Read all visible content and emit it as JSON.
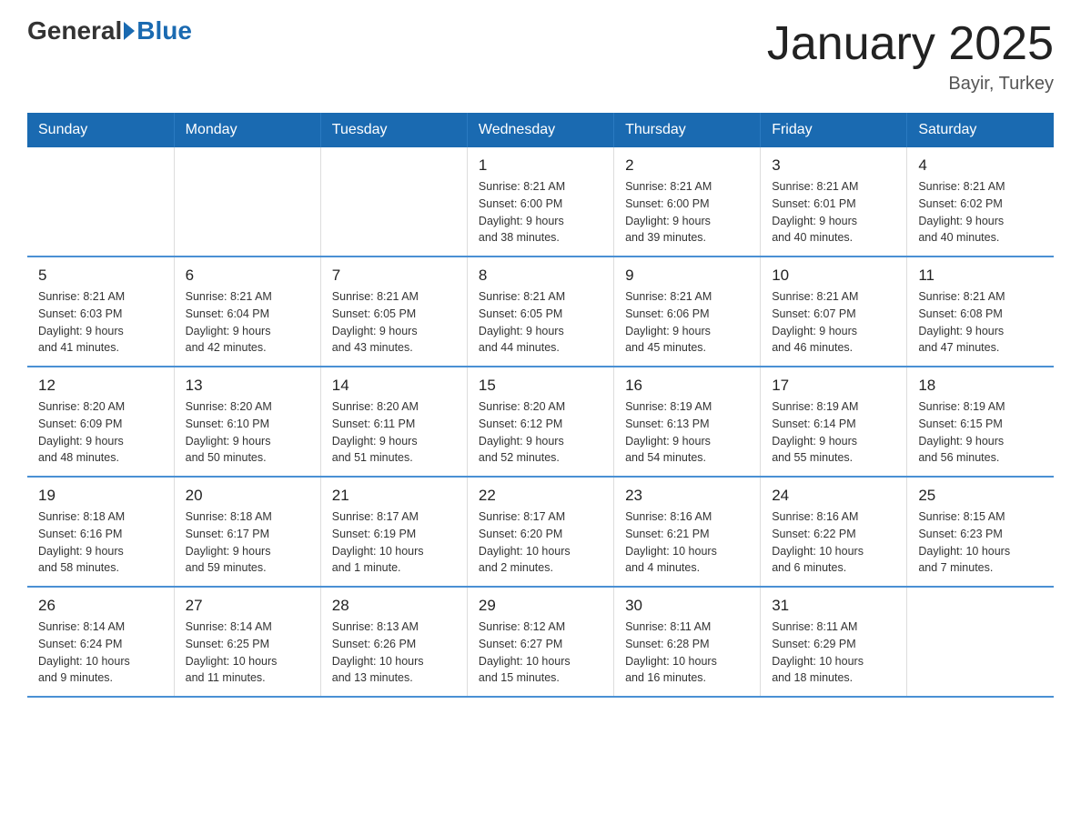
{
  "logo": {
    "general": "General",
    "triangle": "",
    "blue": "Blue"
  },
  "title": "January 2025",
  "location": "Bayir, Turkey",
  "days_header": [
    "Sunday",
    "Monday",
    "Tuesday",
    "Wednesday",
    "Thursday",
    "Friday",
    "Saturday"
  ],
  "weeks": [
    [
      {
        "day": "",
        "info": ""
      },
      {
        "day": "",
        "info": ""
      },
      {
        "day": "",
        "info": ""
      },
      {
        "day": "1",
        "info": "Sunrise: 8:21 AM\nSunset: 6:00 PM\nDaylight: 9 hours\nand 38 minutes."
      },
      {
        "day": "2",
        "info": "Sunrise: 8:21 AM\nSunset: 6:00 PM\nDaylight: 9 hours\nand 39 minutes."
      },
      {
        "day": "3",
        "info": "Sunrise: 8:21 AM\nSunset: 6:01 PM\nDaylight: 9 hours\nand 40 minutes."
      },
      {
        "day": "4",
        "info": "Sunrise: 8:21 AM\nSunset: 6:02 PM\nDaylight: 9 hours\nand 40 minutes."
      }
    ],
    [
      {
        "day": "5",
        "info": "Sunrise: 8:21 AM\nSunset: 6:03 PM\nDaylight: 9 hours\nand 41 minutes."
      },
      {
        "day": "6",
        "info": "Sunrise: 8:21 AM\nSunset: 6:04 PM\nDaylight: 9 hours\nand 42 minutes."
      },
      {
        "day": "7",
        "info": "Sunrise: 8:21 AM\nSunset: 6:05 PM\nDaylight: 9 hours\nand 43 minutes."
      },
      {
        "day": "8",
        "info": "Sunrise: 8:21 AM\nSunset: 6:05 PM\nDaylight: 9 hours\nand 44 minutes."
      },
      {
        "day": "9",
        "info": "Sunrise: 8:21 AM\nSunset: 6:06 PM\nDaylight: 9 hours\nand 45 minutes."
      },
      {
        "day": "10",
        "info": "Sunrise: 8:21 AM\nSunset: 6:07 PM\nDaylight: 9 hours\nand 46 minutes."
      },
      {
        "day": "11",
        "info": "Sunrise: 8:21 AM\nSunset: 6:08 PM\nDaylight: 9 hours\nand 47 minutes."
      }
    ],
    [
      {
        "day": "12",
        "info": "Sunrise: 8:20 AM\nSunset: 6:09 PM\nDaylight: 9 hours\nand 48 minutes."
      },
      {
        "day": "13",
        "info": "Sunrise: 8:20 AM\nSunset: 6:10 PM\nDaylight: 9 hours\nand 50 minutes."
      },
      {
        "day": "14",
        "info": "Sunrise: 8:20 AM\nSunset: 6:11 PM\nDaylight: 9 hours\nand 51 minutes."
      },
      {
        "day": "15",
        "info": "Sunrise: 8:20 AM\nSunset: 6:12 PM\nDaylight: 9 hours\nand 52 minutes."
      },
      {
        "day": "16",
        "info": "Sunrise: 8:19 AM\nSunset: 6:13 PM\nDaylight: 9 hours\nand 54 minutes."
      },
      {
        "day": "17",
        "info": "Sunrise: 8:19 AM\nSunset: 6:14 PM\nDaylight: 9 hours\nand 55 minutes."
      },
      {
        "day": "18",
        "info": "Sunrise: 8:19 AM\nSunset: 6:15 PM\nDaylight: 9 hours\nand 56 minutes."
      }
    ],
    [
      {
        "day": "19",
        "info": "Sunrise: 8:18 AM\nSunset: 6:16 PM\nDaylight: 9 hours\nand 58 minutes."
      },
      {
        "day": "20",
        "info": "Sunrise: 8:18 AM\nSunset: 6:17 PM\nDaylight: 9 hours\nand 59 minutes."
      },
      {
        "day": "21",
        "info": "Sunrise: 8:17 AM\nSunset: 6:19 PM\nDaylight: 10 hours\nand 1 minute."
      },
      {
        "day": "22",
        "info": "Sunrise: 8:17 AM\nSunset: 6:20 PM\nDaylight: 10 hours\nand 2 minutes."
      },
      {
        "day": "23",
        "info": "Sunrise: 8:16 AM\nSunset: 6:21 PM\nDaylight: 10 hours\nand 4 minutes."
      },
      {
        "day": "24",
        "info": "Sunrise: 8:16 AM\nSunset: 6:22 PM\nDaylight: 10 hours\nand 6 minutes."
      },
      {
        "day": "25",
        "info": "Sunrise: 8:15 AM\nSunset: 6:23 PM\nDaylight: 10 hours\nand 7 minutes."
      }
    ],
    [
      {
        "day": "26",
        "info": "Sunrise: 8:14 AM\nSunset: 6:24 PM\nDaylight: 10 hours\nand 9 minutes."
      },
      {
        "day": "27",
        "info": "Sunrise: 8:14 AM\nSunset: 6:25 PM\nDaylight: 10 hours\nand 11 minutes."
      },
      {
        "day": "28",
        "info": "Sunrise: 8:13 AM\nSunset: 6:26 PM\nDaylight: 10 hours\nand 13 minutes."
      },
      {
        "day": "29",
        "info": "Sunrise: 8:12 AM\nSunset: 6:27 PM\nDaylight: 10 hours\nand 15 minutes."
      },
      {
        "day": "30",
        "info": "Sunrise: 8:11 AM\nSunset: 6:28 PM\nDaylight: 10 hours\nand 16 minutes."
      },
      {
        "day": "31",
        "info": "Sunrise: 8:11 AM\nSunset: 6:29 PM\nDaylight: 10 hours\nand 18 minutes."
      },
      {
        "day": "",
        "info": ""
      }
    ]
  ]
}
